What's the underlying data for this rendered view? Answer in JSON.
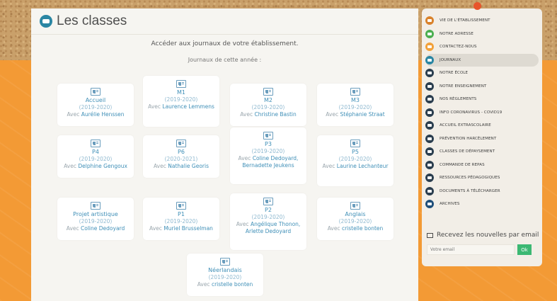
{
  "page": {
    "title": "Les classes"
  },
  "intro": {
    "line1": "Accéder aux journaux de votre établissement.",
    "line2": "Journaux de cette année :"
  },
  "classes": [
    {
      "name": "Accueil",
      "year": "(2019-2020)",
      "with": "Avec",
      "teacher": "Aurélie Henssen"
    },
    {
      "name": "M1",
      "year": "(2019-2020)",
      "with": "Avec",
      "teacher": "Laurence Lemmens"
    },
    {
      "name": "M2",
      "year": "(2019-2020)",
      "with": "Avec",
      "teacher": "Christine Bastin"
    },
    {
      "name": "M3",
      "year": "(2019-2020)",
      "with": "Avec",
      "teacher": "Stéphanie Straat"
    },
    {
      "name": "P4",
      "year": "(2019-2020)",
      "with": "Avec",
      "teacher": "Delphine Gengoux"
    },
    {
      "name": "P6",
      "year": "(2020-2021)",
      "with": "Avec",
      "teacher": "Nathalie Georis"
    },
    {
      "name": "P3",
      "year": "(2019-2020)",
      "with": "Avec",
      "teacher": "Coline Dedoyard, Bernadette Jeukens"
    },
    {
      "name": "P5",
      "year": "(2019-2020)",
      "with": "Avec",
      "teacher": "Laurine Lechanteur"
    },
    {
      "name": "Projet artistique",
      "year": "(2019-2020)",
      "with": "Avec",
      "teacher": "Coline Dedoyard"
    },
    {
      "name": "P1",
      "year": "(2019-2020)",
      "with": "Avec",
      "teacher": "Muriel Brusselman"
    },
    {
      "name": "P2",
      "year": "(2019-2020)",
      "with": "Avec",
      "teacher": "Angélique Thonon, Arlette Dedoyard"
    },
    {
      "name": "Anglais",
      "year": "(2019-2020)",
      "with": "Avec",
      "teacher": "cristelle bonten"
    },
    {
      "name": "Néerlandais",
      "year": "(2019-2020)",
      "with": "Avec",
      "teacher": "cristelle bonten"
    }
  ],
  "menu": [
    {
      "label": "VIE DE L'ÉTABLISSEMENT",
      "color": "#d9822b",
      "icon": "school-icon"
    },
    {
      "label": "NOTRE ADRESSE",
      "color": "#4caf50",
      "icon": "map-pin-icon"
    },
    {
      "label": "CONTACTEZ-NOUS",
      "color": "#f2a13a",
      "icon": "mail-icon"
    },
    {
      "label": "JOURNAUX",
      "color": "#2a86a3",
      "icon": "newspaper-icon",
      "active": true
    },
    {
      "label": "NOTRE ÉCOLE",
      "color": "#2b3e4f",
      "icon": "book-icon"
    },
    {
      "label": "NOTRE ENSEIGNEMENT",
      "color": "#2b3e4f",
      "icon": "book-icon"
    },
    {
      "label": "NOS RÈGLEMENTS",
      "color": "#2b3e4f",
      "icon": "book-icon"
    },
    {
      "label": "INFO CORONAVIRUS - COVID19",
      "color": "#2b3e4f",
      "icon": "book-icon"
    },
    {
      "label": "ACCUEIL EXTRASCOLAIRE",
      "color": "#2b3e4f",
      "icon": "book-icon"
    },
    {
      "label": "PRÉVENTION HARCÈLEMENT",
      "color": "#2b3e4f",
      "icon": "book-icon"
    },
    {
      "label": "CLASSES DE DÉPAYSEMENT",
      "color": "#2b3e4f",
      "icon": "book-icon"
    },
    {
      "label": "COMMANDE DE REPAS",
      "color": "#2b3e4f",
      "icon": "book-icon"
    },
    {
      "label": "RESSOURCES PÉDAGOGIQUES",
      "color": "#2b3e4f",
      "icon": "book-icon"
    },
    {
      "label": "DOCUMENTS À TÉLÉCHARGER",
      "color": "#2b3e4f",
      "icon": "book-icon"
    },
    {
      "label": "ARCHIVES",
      "color": "#1f4f7a",
      "icon": "archive-icon"
    }
  ],
  "newsletter": {
    "title": "Recevez les nouvelles par email",
    "placeholder": "Votre email",
    "button": "Ok"
  },
  "colors": {
    "accent": "#3f8fb7",
    "background": "#f39a35",
    "ok_button": "#3cb873"
  }
}
